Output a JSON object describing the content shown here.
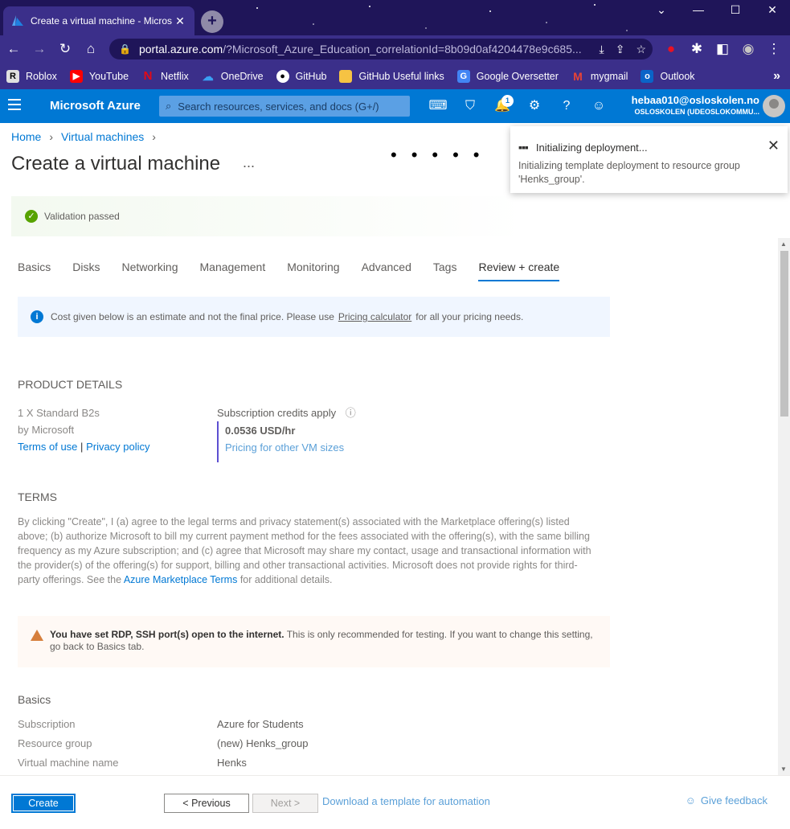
{
  "browser": {
    "tab_title": "Create a virtual machine - Micros",
    "url_host": "portal.azure.com",
    "url_path": "/?Microsoft_Azure_Education_correlationId=8b09d0af4204478e9c685...",
    "bookmarks": [
      "Roblox",
      "YouTube",
      "Netflix",
      "OneDrive",
      "GitHub",
      "GitHub Useful links",
      "Google Oversetter",
      "mygmail",
      "Outlook"
    ]
  },
  "azure": {
    "brand": "Microsoft Azure",
    "search_placeholder": "Search resources, services, and docs (G+/)",
    "notification_count": "1",
    "account_email": "hebaa010@osloskolen.no",
    "account_org": "OSLOSKOLEN (UDEOSLOKOMMU..."
  },
  "breadcrumb": {
    "home": "Home",
    "vms": "Virtual machines"
  },
  "page": {
    "title": "Create a virtual machine",
    "more": "..."
  },
  "validation": "Validation passed",
  "tabs": [
    "Basics",
    "Disks",
    "Networking",
    "Management",
    "Monitoring",
    "Advanced",
    "Tags",
    "Review + create"
  ],
  "info": {
    "text1": "Cost given below is an estimate and not the final price. Please use",
    "link": "Pricing calculator",
    "text2": "for all your pricing needs."
  },
  "product": {
    "heading": "PRODUCT DETAILS",
    "name": "1 X Standard B2s",
    "by": "by Microsoft",
    "terms_link": "Terms of use",
    "sep": "|",
    "privacy_link": "Privacy policy",
    "credits": "Subscription credits apply",
    "price": "0.0536 USD/hr",
    "pricing_link": "Pricing for other VM sizes"
  },
  "terms": {
    "heading": "TERMS",
    "body1": "By clicking \"Create\", I (a) agree to the legal terms and privacy statement(s) associated with the Marketplace offering(s) listed above; (b) authorize Microsoft to bill my current payment method for the fees associated with the offering(s), with the same billing frequency as my Azure subscription; and (c) agree that Microsoft may share my contact, usage and transactional information with the provider(s) of the offering(s) for support, billing and other transactional activities. Microsoft does not provide rights for third-party offerings. See the",
    "link": "Azure Marketplace Terms",
    "body2": "for additional details."
  },
  "warning": {
    "bold": "You have set RDP, SSH port(s) open to the internet.",
    "text": "This is only recommended for testing.  If you want to change this setting, go back to Basics tab."
  },
  "basics": {
    "heading": "Basics",
    "rows": [
      {
        "key": "Subscription",
        "value": "Azure for Students"
      },
      {
        "key": "Resource group",
        "value": "(new) Henks_group"
      },
      {
        "key": "Virtual machine name",
        "value": "Henks"
      }
    ]
  },
  "footer": {
    "create": "Create",
    "previous": "< Previous",
    "next": "Next >",
    "download": "Download a template for automation",
    "feedback": "Give feedback"
  },
  "toast": {
    "title": "Initializing deployment...",
    "message": "Initializing template deployment to resource group 'Henks_group'."
  }
}
